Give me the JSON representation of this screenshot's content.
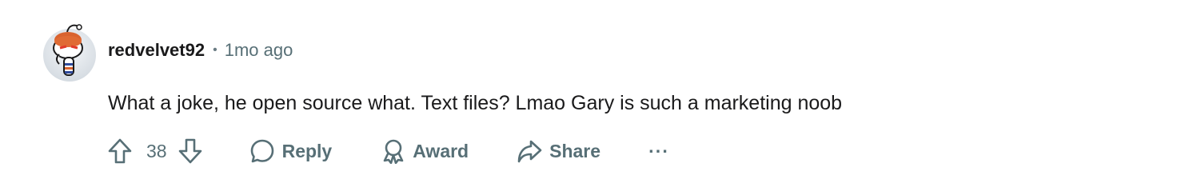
{
  "comment": {
    "username": "redvelvet92",
    "separator": "•",
    "timestamp": "1mo ago",
    "text": "What a joke, he open source what. Text files? Lmao Gary is such a marketing noob"
  },
  "actions": {
    "vote_count": "38",
    "reply_label": "Reply",
    "award_label": "Award",
    "share_label": "Share",
    "more_label": "···"
  },
  "icons": {
    "avatar": "snoo-avatar",
    "upvote": "arrow-up-icon",
    "downvote": "arrow-down-icon",
    "reply": "speech-bubble-icon",
    "award": "ribbon-icon",
    "share": "share-arrow-icon",
    "more": "ellipsis-icon"
  },
  "colors": {
    "text": "#1a1a1b",
    "secondary": "#576f76",
    "background": "#ffffff"
  }
}
